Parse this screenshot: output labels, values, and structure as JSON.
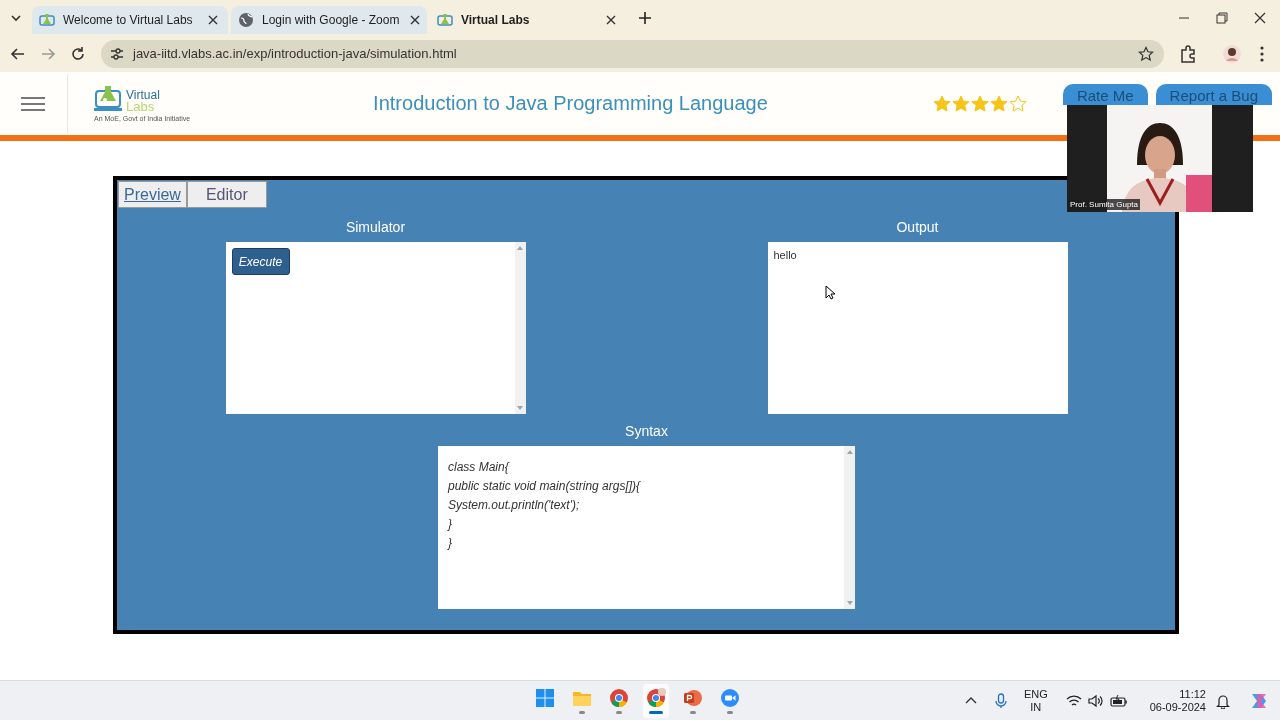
{
  "browser": {
    "tabs": [
      {
        "title": "Welcome to Virtual Labs",
        "kind": "vlabs",
        "selected": false
      },
      {
        "title": "Login with Google - Zoom",
        "kind": "globe",
        "selected": false
      },
      {
        "title": "Virtual Labs",
        "kind": "vlabs",
        "selected": true
      }
    ],
    "address": "java-iitd.vlabs.ac.in/exp/introduction-java/simulation.html"
  },
  "header": {
    "logo": {
      "line1": "Virtual",
      "line2": "Labs",
      "tagline": "An MoE, Govt of India Initiative"
    },
    "title": "Introduction to Java Programming Language",
    "stars": 4,
    "buttons": [
      "Rate Me",
      "Report a Bug"
    ]
  },
  "simulation": {
    "tabs": [
      {
        "label": "Preview",
        "selected": true
      },
      {
        "label": "Editor",
        "selected": false
      }
    ],
    "simulator": {
      "heading": "Simulator",
      "button": "Execute"
    },
    "output": {
      "heading": "Output",
      "text": "hello"
    },
    "syntax": {
      "heading": "Syntax",
      "lines": [
        "class Main{",
        "public static void main(string args[]){",
        "System.out.println('text');",
        "}",
        "}"
      ]
    }
  },
  "video": {
    "name": "Prof. Sumita Gupta"
  },
  "taskbar": {
    "apps": [
      {
        "kind": "windows",
        "running": false,
        "active": false
      },
      {
        "kind": "files",
        "running": true,
        "active": false
      },
      {
        "kind": "chrome",
        "running": true,
        "active": false
      },
      {
        "kind": "chrome-profile",
        "running": true,
        "active": true
      },
      {
        "kind": "powerpoint",
        "running": true,
        "active": false
      },
      {
        "kind": "zoom",
        "running": true,
        "active": false
      }
    ],
    "language": [
      "ENG",
      "IN"
    ],
    "time": "11:12",
    "date": "06-09-2024"
  }
}
